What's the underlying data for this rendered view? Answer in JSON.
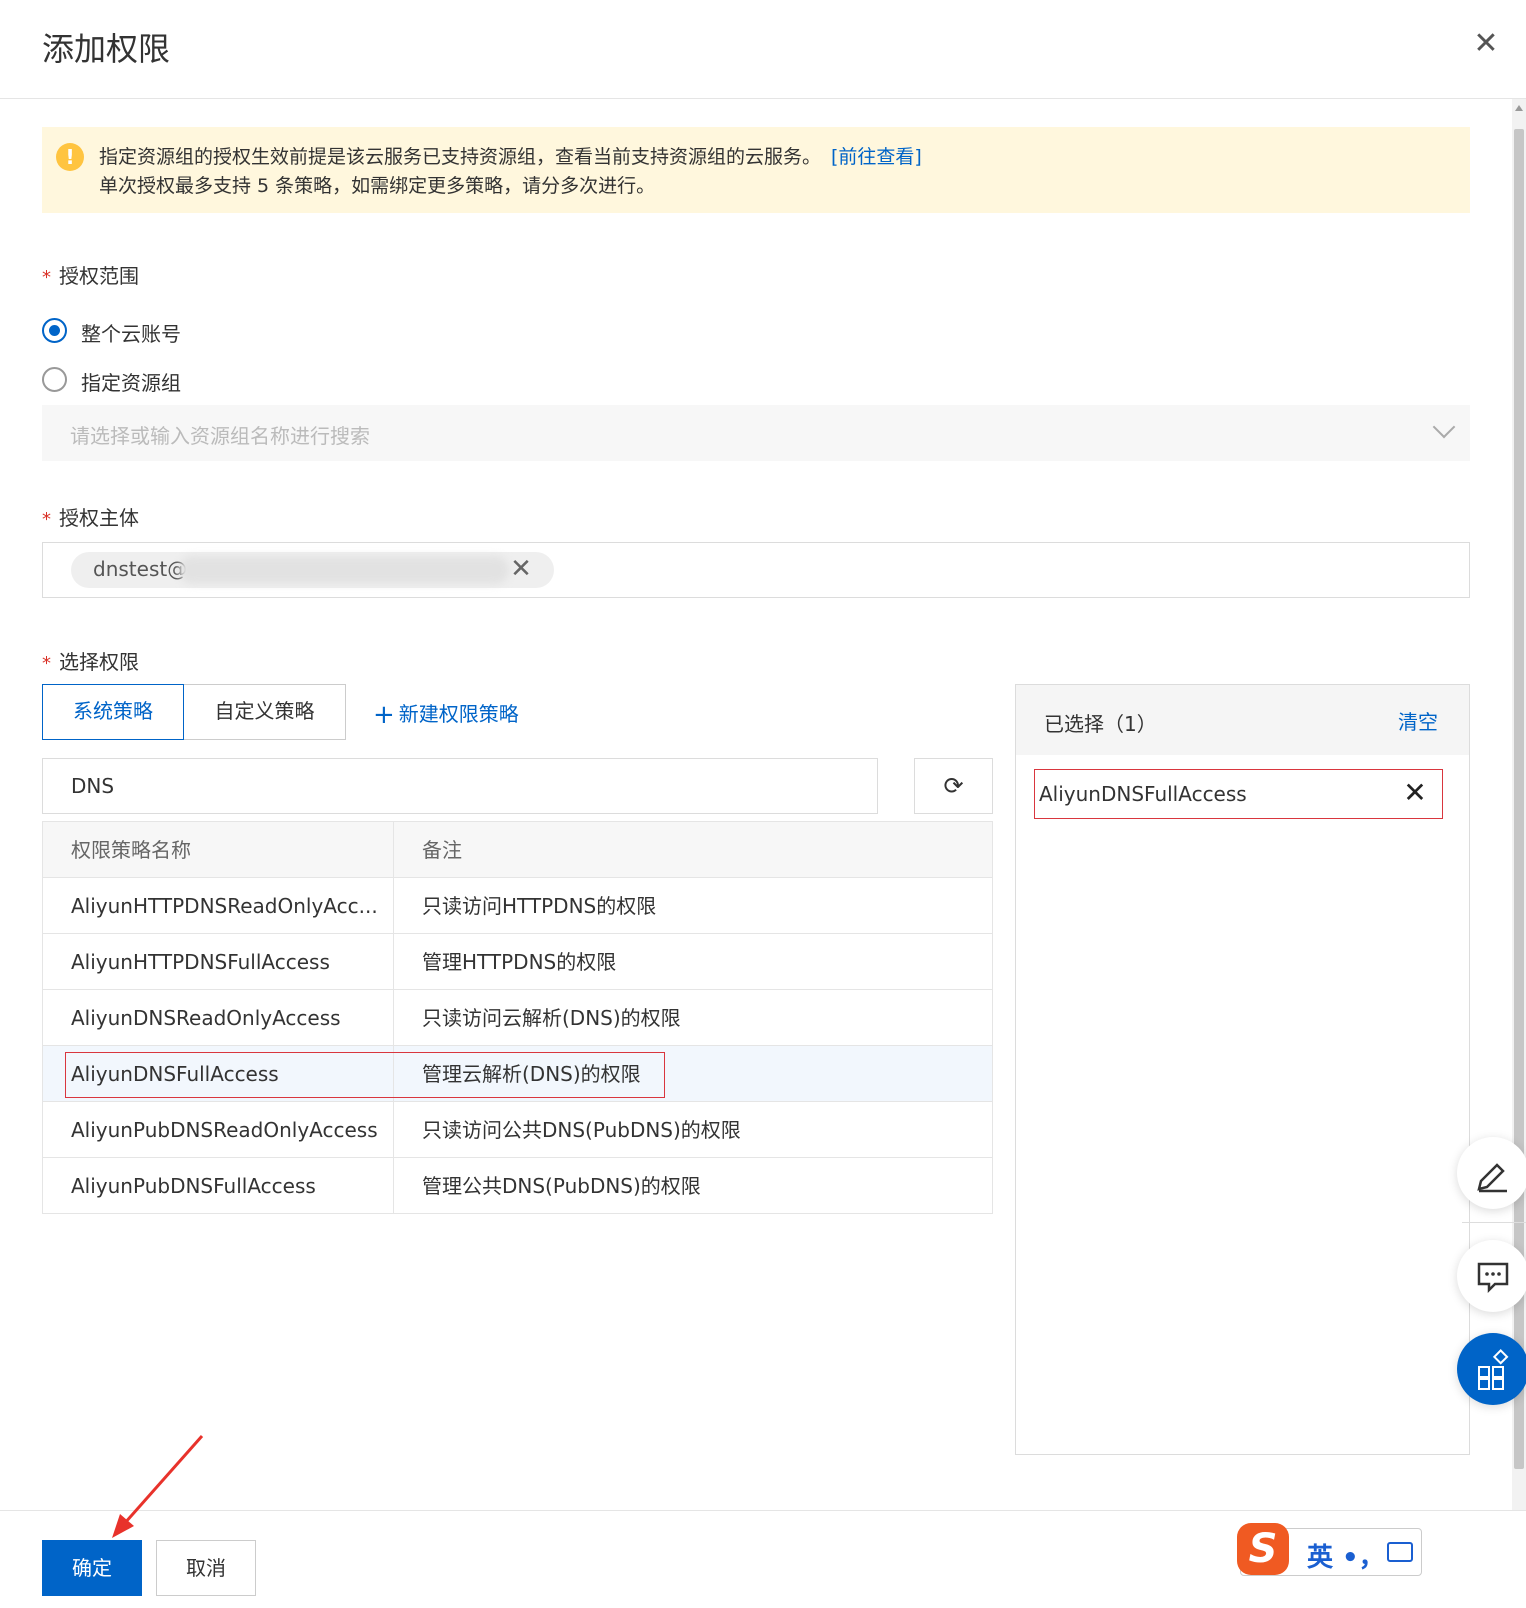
{
  "dialog": {
    "title": "添加权限",
    "close_icon": "close-icon"
  },
  "notice": {
    "line1": "指定资源组的授权生效前提是该云服务已支持资源组，查看当前支持资源组的云服务。",
    "link": "[前往查看]",
    "line2": "单次授权最多支持 5 条策略，如需绑定更多策略，请分多次进行。",
    "icon": "warning-icon"
  },
  "scope": {
    "required_mark": "*",
    "label": "授权范围",
    "options": [
      {
        "label": "整个云账号",
        "checked": true
      },
      {
        "label": "指定资源组",
        "checked": false
      }
    ],
    "select_placeholder": "请选择或输入资源组名称进行搜索"
  },
  "principal": {
    "required_mark": "*",
    "label": "授权主体",
    "tag_text": "dnstest@"
  },
  "permissions": {
    "required_mark": "*",
    "label": "选择权限",
    "tabs": [
      {
        "label": "系统策略",
        "active": true
      },
      {
        "label": "自定义策略",
        "active": false
      }
    ],
    "new_policy_label": "新建权限策略",
    "search_value": "DNS",
    "table": {
      "columns": [
        "权限策略名称",
        "备注"
      ],
      "rows": [
        {
          "name": "AliyunHTTPDNSReadOnlyAcc...",
          "note": "只读访问HTTPDNS的权限"
        },
        {
          "name": "AliyunHTTPDNSFullAccess",
          "note": "管理HTTPDNS的权限"
        },
        {
          "name": "AliyunDNSReadOnlyAccess",
          "note": "只读访问云解析(DNS)的权限"
        },
        {
          "name": "AliyunDNSFullAccess",
          "note": "管理云解析(DNS)的权限",
          "highlighted": true
        },
        {
          "name": "AliyunPubDNSReadOnlyAccess",
          "note": "只读访问公共DNS(PubDNS)的权限"
        },
        {
          "name": "AliyunPubDNSFullAccess",
          "note": "管理公共DNS(PubDNS)的权限"
        }
      ]
    }
  },
  "selected": {
    "title": "已选择（1）",
    "clear_label": "清空",
    "items": [
      "AliyunDNSFullAccess"
    ]
  },
  "footer": {
    "confirm_label": "确定",
    "cancel_label": "取消"
  },
  "ime": {
    "logo": "S",
    "text": "英 •，"
  },
  "colors": {
    "primary": "#0064c8",
    "warning_bg": "#fff7dd",
    "warning_icon": "#ffc440",
    "annotation_red": "#d9363e"
  }
}
